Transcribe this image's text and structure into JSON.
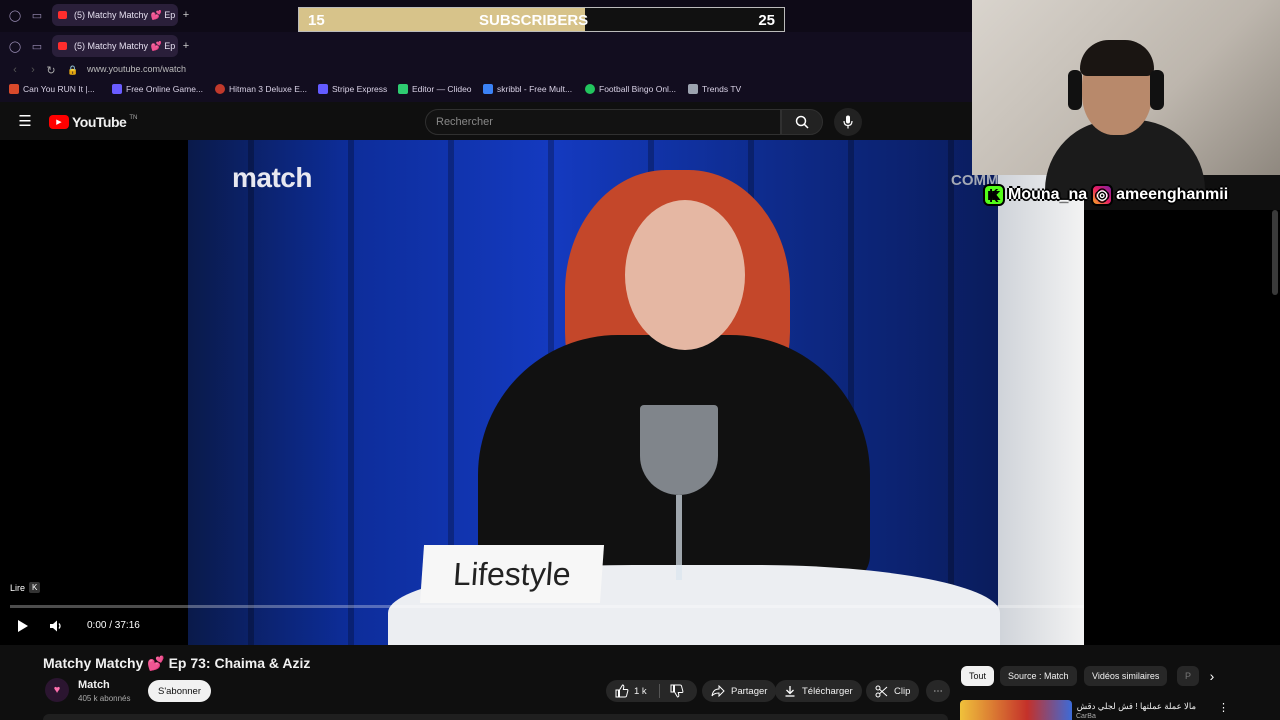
{
  "browser": {
    "tabs": [
      {
        "title": "(5) Matchy Matchy 💕 Ep"
      },
      {
        "title": "(5) Matchy Matchy 💕 Ep"
      }
    ],
    "new_tab_label": "+",
    "url": "www.youtube.com/watch",
    "bookmarks": [
      {
        "label": "Can You RUN It |...",
        "color": "#d94a2b"
      },
      {
        "label": "Free Online Game...",
        "color": "#6a5cff"
      },
      {
        "label": "Hitman 3 Deluxe E...",
        "color": "#c0392b"
      },
      {
        "label": "Stripe Express",
        "color": "#635bff"
      },
      {
        "label": "Editor — Clideo",
        "color": "#2ecc71"
      },
      {
        "label": "skribbl - Free Mult...",
        "color": "#3b82f6"
      },
      {
        "label": "Football Bingo Onl...",
        "color": "#22c55e"
      },
      {
        "label": "Trends TV",
        "color": "#9ca3af"
      }
    ]
  },
  "subscriber_goal": {
    "left": "15",
    "label": "SUBSCRIBERS",
    "right": "25",
    "progress": 0.59
  },
  "youtube": {
    "logo_text": "YouTube",
    "logo_region": "TN",
    "search_placeholder": "Rechercher"
  },
  "video": {
    "brand_logo": "match",
    "partial_text": "COMM",
    "card_text": "Lifestyle",
    "play_tooltip": "Lire",
    "play_key": "K",
    "time": "0:00 / 37:16",
    "progress": 0.0
  },
  "stream_overlay": {
    "kick_handle": "Mouna_na",
    "instagram_handle": "ameenghanmii"
  },
  "details": {
    "title": "Matchy Matchy 💕 Ep 73: Chaima & Aziz",
    "channel": "Match",
    "subscribers": "405 k abonnés",
    "subscribe_label": "S'abonner",
    "likes": "1 k",
    "share_label": "Partager",
    "download_label": "Télécharger",
    "clip_label": "Clip",
    "more_label": "⋯"
  },
  "sidebar": {
    "chips": [
      "Tout",
      "Source : Match",
      "Vidéos similaires",
      "P"
    ],
    "related_title": "مالا عملة عملتها ! فش لجلي دقش",
    "related_channel": "CarBa"
  },
  "colors": {
    "accent_red": "#ff0000",
    "goal_fill": "#d7c38a",
    "kick_green": "#53fc18"
  }
}
